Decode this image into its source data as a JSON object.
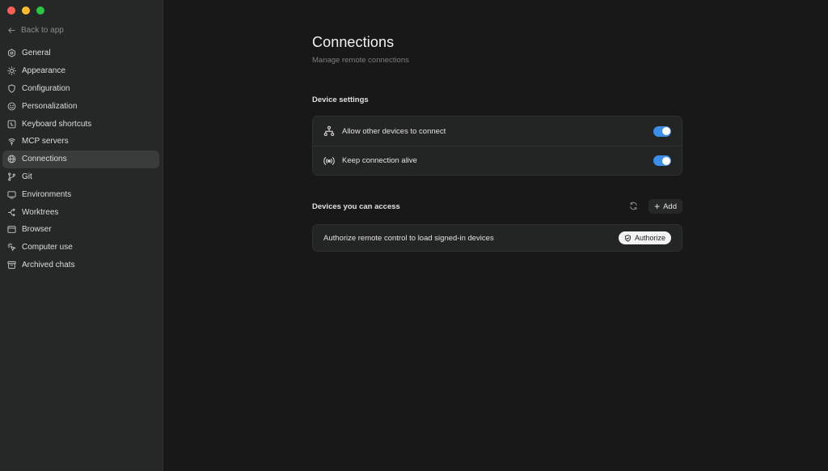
{
  "sidebar": {
    "back_label": "Back to app",
    "items": [
      {
        "label": "General",
        "icon": "gear-icon"
      },
      {
        "label": "Appearance",
        "icon": "sun-icon"
      },
      {
        "label": "Configuration",
        "icon": "shield-icon"
      },
      {
        "label": "Personalization",
        "icon": "smile-icon"
      },
      {
        "label": "Keyboard shortcuts",
        "icon": "keyboard-icon"
      },
      {
        "label": "MCP servers",
        "icon": "plug-icon"
      },
      {
        "label": "Connections",
        "icon": "globe-icon",
        "active": true
      },
      {
        "label": "Git",
        "icon": "git-branch-icon"
      },
      {
        "label": "Environments",
        "icon": "monitor-icon"
      },
      {
        "label": "Worktrees",
        "icon": "worktree-icon"
      },
      {
        "label": "Browser",
        "icon": "browser-icon"
      },
      {
        "label": "Computer use",
        "icon": "cursor-icon"
      },
      {
        "label": "Archived chats",
        "icon": "archive-icon"
      }
    ]
  },
  "main": {
    "title": "Connections",
    "subtitle": "Manage remote connections",
    "device_settings": {
      "label": "Device settings",
      "rows": [
        {
          "label": "Allow other devices to connect",
          "icon": "network-icon",
          "enabled": true
        },
        {
          "label": "Keep connection alive",
          "icon": "broadcast-icon",
          "enabled": true
        }
      ]
    },
    "devices": {
      "label": "Devices you can access",
      "add_label": "Add",
      "rows": [
        {
          "label": "Authorize remote control to load signed-in devices",
          "button_label": "Authorize"
        }
      ]
    }
  },
  "colors": {
    "accent": "#3d8ee8",
    "sidebar_bg": "#262828",
    "main_bg": "#181818"
  }
}
